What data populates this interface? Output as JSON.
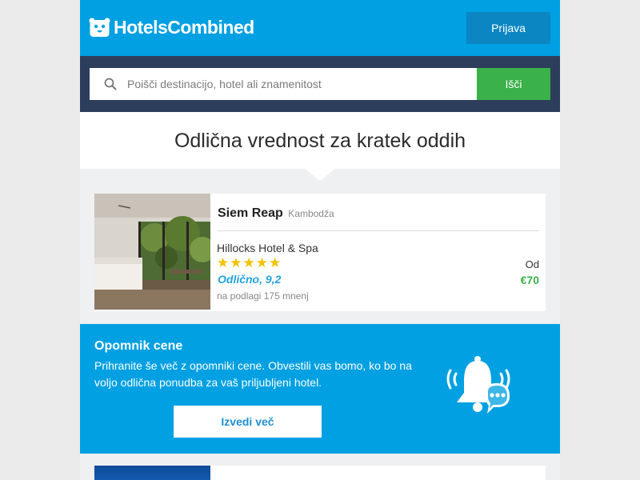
{
  "header": {
    "logo_text": "HotelsCombined",
    "login_label": "Prijava"
  },
  "search": {
    "placeholder": "Poišči destinacijo, hotel ali znamenitost",
    "button_label": "Išči"
  },
  "headline": "Odlična vrednost za kratek oddih",
  "deal": {
    "destination": "Siem Reap",
    "country": "Kambodža",
    "hotel_name": "Hillocks Hotel & Spa",
    "stars": 5,
    "rating_text": "Odlično, 9,2",
    "reviews_text": "na podlagi 175 mnenj",
    "price_prefix": "Od",
    "price": "€70"
  },
  "price_alert": {
    "title": "Opomnik cene",
    "text": "Prihranite še več z opomniki cene. Obvestili vas bomo, ko bo na voljo odlična ponudba za vaš priljubljeni hotel.",
    "button_label": "Izvedi več",
    "icon": "bell-chat-icon"
  },
  "colors": {
    "brand_blue": "#00a0e2",
    "search_bar": "#2c3e5b",
    "search_button": "#3bb14a",
    "login_button": "#0b86c3",
    "price_green": "#3bb14a",
    "star_yellow": "#f2c200"
  }
}
